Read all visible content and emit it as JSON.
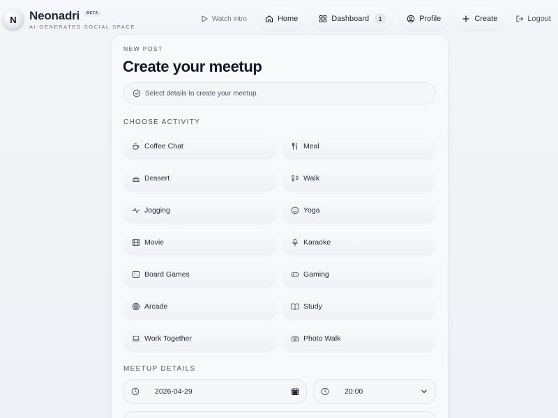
{
  "brand": {
    "logo_letter": "N",
    "name": "Neonadri",
    "badge": "BETA",
    "tagline": "AI-GENERATED SOCIAL SPACE"
  },
  "nav": {
    "watch_intro": "Watch intro",
    "home": "Home",
    "dashboard": "Dashboard",
    "dashboard_count": "1",
    "profile": "Profile",
    "create": "Create",
    "logout": "Logout"
  },
  "form": {
    "eyebrow": "NEW POST",
    "title": "Create your meetup",
    "hint": "Select details to create your meetup.",
    "activity_section": "CHOOSE ACTIVITY",
    "activities": [
      {
        "label": "Coffee Chat",
        "icon": "coffee-icon"
      },
      {
        "label": "Meal",
        "icon": "utensils-icon"
      },
      {
        "label": "Dessert",
        "icon": "cake-icon"
      },
      {
        "label": "Walk",
        "icon": "footprints-icon"
      },
      {
        "label": "Jogging",
        "icon": "activity-icon"
      },
      {
        "label": "Yoga",
        "icon": "smile-icon"
      },
      {
        "label": "Movie",
        "icon": "film-icon"
      },
      {
        "label": "Karaoke",
        "icon": "mic-icon"
      },
      {
        "label": "Board Games",
        "icon": "dice-icon"
      },
      {
        "label": "Gaming",
        "icon": "gamepad-icon"
      },
      {
        "label": "Arcade",
        "icon": "target-icon"
      },
      {
        "label": "Study",
        "icon": "book-icon"
      },
      {
        "label": "Work Together",
        "icon": "laptop-icon"
      },
      {
        "label": "Photo Walk",
        "icon": "camera-icon"
      }
    ],
    "details_section": "MEETUP DETAILS",
    "date_value": "2026-04-29",
    "time_value": "20:00"
  }
}
